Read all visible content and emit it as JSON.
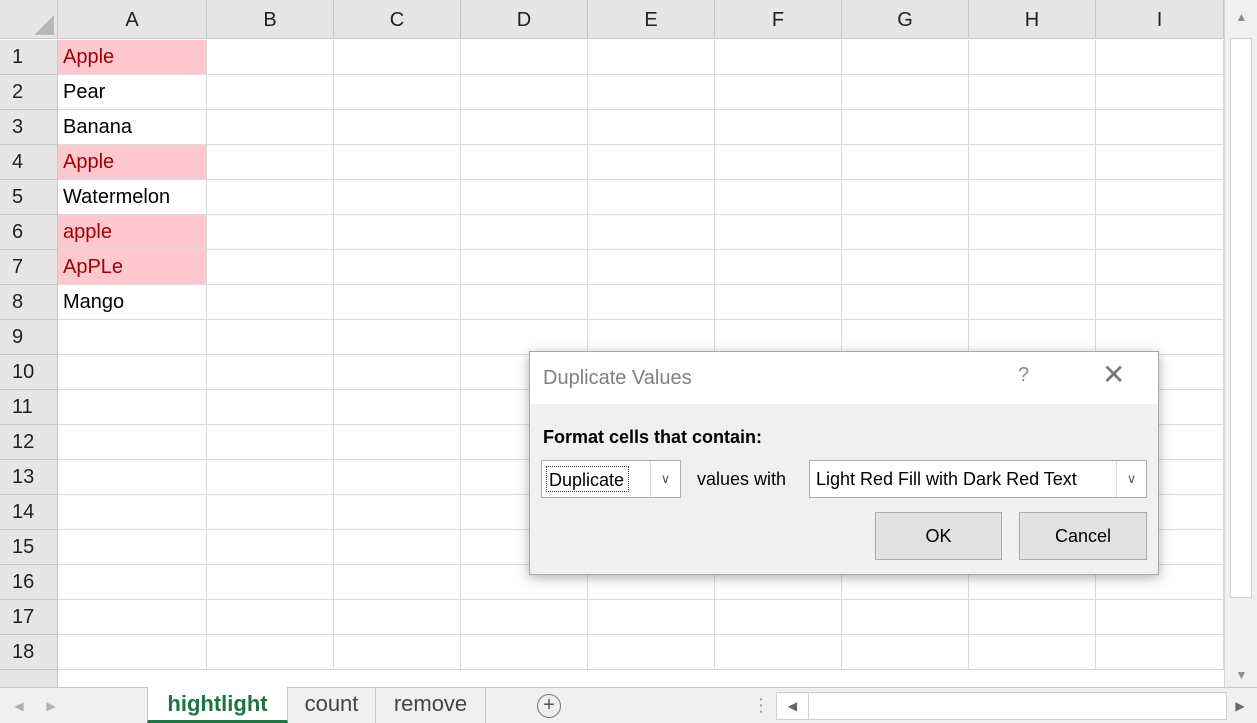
{
  "columns": [
    "A",
    "B",
    "C",
    "D",
    "E",
    "F",
    "G",
    "H",
    "I"
  ],
  "rows": [
    {
      "num": "1",
      "a": "Apple",
      "duplicate": true
    },
    {
      "num": "2",
      "a": "Pear",
      "duplicate": false
    },
    {
      "num": "3",
      "a": "Banana",
      "duplicate": false
    },
    {
      "num": "4",
      "a": "Apple",
      "duplicate": true
    },
    {
      "num": "5",
      "a": "Watermelon",
      "duplicate": false
    },
    {
      "num": "6",
      "a": "apple",
      "duplicate": true
    },
    {
      "num": "7",
      "a": "ApPLe",
      "duplicate": true
    },
    {
      "num": "8",
      "a": "Mango",
      "duplicate": false
    },
    {
      "num": "9",
      "a": "",
      "duplicate": false
    },
    {
      "num": "10",
      "a": "",
      "duplicate": false
    },
    {
      "num": "11",
      "a": "",
      "duplicate": false
    },
    {
      "num": "12",
      "a": "",
      "duplicate": false
    },
    {
      "num": "13",
      "a": "",
      "duplicate": false
    },
    {
      "num": "14",
      "a": "",
      "duplicate": false
    },
    {
      "num": "15",
      "a": "",
      "duplicate": false
    },
    {
      "num": "16",
      "a": "",
      "duplicate": false
    },
    {
      "num": "17",
      "a": "",
      "duplicate": false
    },
    {
      "num": "18",
      "a": "",
      "duplicate": false
    }
  ],
  "sheet_tabs": [
    {
      "label": "hightlight",
      "active": true
    },
    {
      "label": "count",
      "active": false
    },
    {
      "label": "remove",
      "active": false
    }
  ],
  "add_sheet_symbol": "+",
  "dialog": {
    "title": "Duplicate Values",
    "help_symbol": "?",
    "close_symbol": "✕",
    "label": "Format cells that contain:",
    "type_value": "Duplicate",
    "values_with_text": "values with",
    "format_value": "Light Red Fill with Dark Red Text",
    "ok_label": "OK",
    "cancel_label": "Cancel"
  },
  "colors": {
    "duplicate_fill": "#ffc7ce",
    "duplicate_text": "#9c0006",
    "excel_green": "#217346",
    "header_bg": "#e6e6e6"
  },
  "icons": {
    "scroll_up": "scroll-up-arrow-icon",
    "scroll_down": "scroll-down-arrow-icon",
    "scroll_left": "scroll-left-arrow-icon",
    "scroll_right": "scroll-right-arrow-icon",
    "dropdown": "chevron-down-icon",
    "close": "close-icon",
    "help": "help-icon",
    "add_sheet": "plus-circle-icon"
  }
}
